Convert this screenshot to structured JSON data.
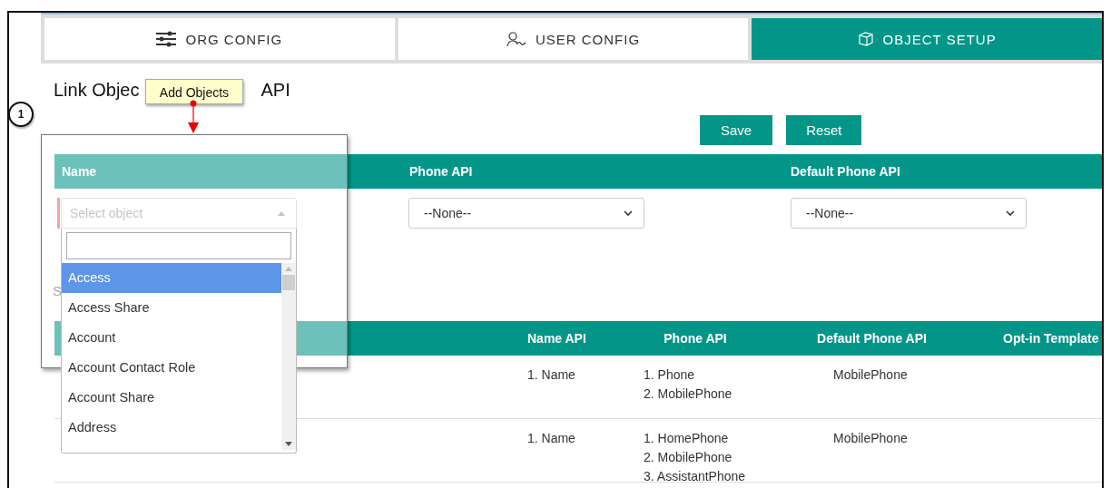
{
  "tabs": [
    {
      "label": "ORG CONFIG",
      "selected": false
    },
    {
      "label": "USER CONFIG",
      "selected": false
    },
    {
      "label": "OBJECT SETUP",
      "selected": true
    }
  ],
  "title": {
    "start": "Link Objec",
    "end": "API"
  },
  "buttons": [
    "Save",
    "Reset"
  ],
  "link_table": {
    "columns": [
      "Name",
      "Phone API",
      "Default Phone API"
    ],
    "object_select": {
      "placeholder": "Select object",
      "required": true
    },
    "phone_select": {
      "value": "--None--"
    },
    "default_phone_select": {
      "value": "--None--"
    }
  },
  "dropdown": {
    "options": [
      {
        "label": "Access",
        "selected": true
      },
      {
        "label": "Access Share",
        "selected": false
      },
      {
        "label": "Account",
        "selected": false
      },
      {
        "label": "Account Contact Role",
        "selected": false
      },
      {
        "label": "Account Share",
        "selected": false
      },
      {
        "label": "Address",
        "selected": false
      }
    ]
  },
  "section_label": "S",
  "objects_table": {
    "columns": [
      "Name API",
      "Phone API",
      "Default Phone API",
      "Opt-in Template"
    ],
    "rows": [
      {
        "name_api": [
          "1. Name"
        ],
        "phone_api": [
          "1. Phone",
          "2. MobilePhone"
        ],
        "default_phone_api": "MobilePhone"
      },
      {
        "name_api": [
          "1. Name"
        ],
        "phone_api": [
          "1. HomePhone",
          "2. MobilePhone",
          "3. AssistantPhone"
        ],
        "default_phone_api": "MobilePhone"
      }
    ]
  },
  "callout": {
    "number": "1",
    "label": "Add Objects"
  }
}
